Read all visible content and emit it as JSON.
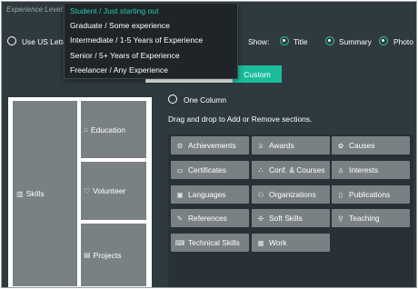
{
  "experience": {
    "label": "Experience Level:",
    "options": [
      "Student / Just starting out",
      "Graduate / Some experience",
      "Intermediate / 1-5 Years of Experience",
      "Senior / 5+ Years of Experience",
      "Freelancer / Any Experience"
    ],
    "selected_index": 0
  },
  "options_row": {
    "us_letter_label": "Use US Letter F",
    "show_label": "Show:",
    "show_items": [
      {
        "label": "Title",
        "checked": true
      },
      {
        "label": "Summary",
        "checked": true
      },
      {
        "label": "Photo",
        "checked": true
      }
    ]
  },
  "layout": {
    "custom_label": "Custom",
    "one_column_label": "One Column",
    "instructions": "Drag and drop to Add or Remove sections."
  },
  "preview": {
    "blocks": [
      {
        "label": "Skills",
        "icon": "skills-icon"
      },
      {
        "label": "Education",
        "icon": "education-icon"
      },
      {
        "label": "Volunteer",
        "icon": "volunteer-icon"
      },
      {
        "label": "Projects",
        "icon": "projects-icon"
      }
    ]
  },
  "sections": [
    {
      "label": "Achievements",
      "icon": "achievements-icon"
    },
    {
      "label": "Awards",
      "icon": "awards-icon"
    },
    {
      "label": "Causes",
      "icon": "causes-icon"
    },
    {
      "label": "Certificates",
      "icon": "certificates-icon"
    },
    {
      "label": "Conf. & Courses",
      "icon": "courses-icon"
    },
    {
      "label": "Interests",
      "icon": "interests-icon"
    },
    {
      "label": "Languages",
      "icon": "languages-icon"
    },
    {
      "label": "Organizations",
      "icon": "organizations-icon"
    },
    {
      "label": "Publications",
      "icon": "publications-icon"
    },
    {
      "label": "References",
      "icon": "references-icon"
    },
    {
      "label": "Soft Skills",
      "icon": "soft-skills-icon"
    },
    {
      "label": "Teaching",
      "icon": "teaching-icon"
    },
    {
      "label": "Technical Skills",
      "icon": "technical-skills-icon"
    },
    {
      "label": "Work",
      "icon": "work-icon"
    }
  ],
  "colors": {
    "background": "#2f3a3f",
    "accent": "#1abc9c",
    "chip": "#7a8185"
  }
}
